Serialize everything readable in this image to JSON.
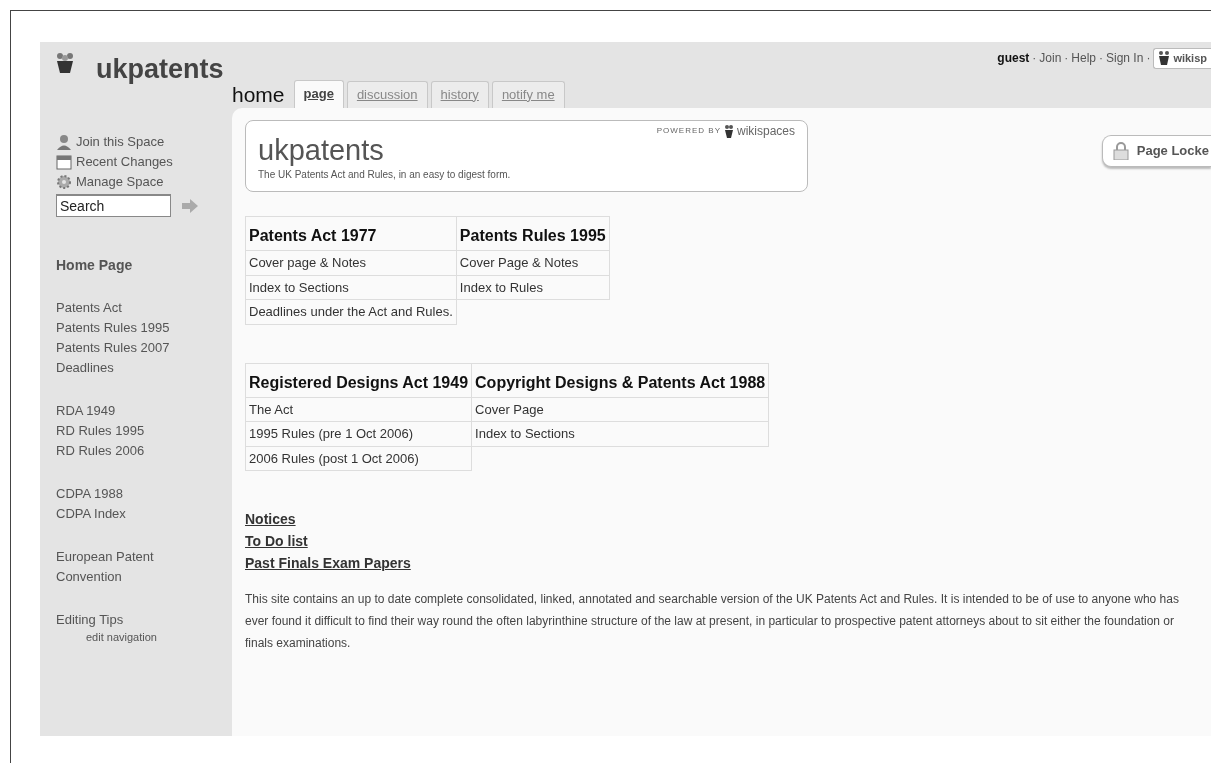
{
  "site": {
    "name": "ukpatents"
  },
  "user_bar": {
    "user": "guest",
    "links": [
      "Join",
      "Help",
      "Sign In"
    ],
    "separator": "·",
    "brand": "wikisp"
  },
  "page_name": "home",
  "tabs": [
    {
      "label": "page",
      "selected": true
    },
    {
      "label": "discussion",
      "selected": false
    },
    {
      "label": "history",
      "selected": false
    },
    {
      "label": "notify me",
      "selected": false
    }
  ],
  "sidebar": {
    "actions": [
      {
        "label": "Join this Space"
      },
      {
        "label": "Recent Changes"
      },
      {
        "label": "Manage Space"
      }
    ],
    "search": {
      "value": "Search"
    },
    "nav_groups": [
      {
        "items": [
          {
            "label": "Home Page",
            "bold": true
          }
        ]
      },
      {
        "items": [
          {
            "label": "Patents Act",
            "bold": false
          },
          {
            "label": "Patents Rules 1995",
            "bold": false
          },
          {
            "label": "Patents Rules 2007",
            "bold": false
          },
          {
            "label": "Deadlines",
            "bold": false
          }
        ]
      },
      {
        "items": [
          {
            "label": "RDA 1949",
            "bold": false
          },
          {
            "label": "RD Rules 1995",
            "bold": false
          },
          {
            "label": "RD Rules 2006",
            "bold": false
          }
        ]
      },
      {
        "items": [
          {
            "label": "CDPA 1988",
            "bold": false
          },
          {
            "label": "CDPA Index",
            "bold": false
          }
        ]
      },
      {
        "items": [
          {
            "label": "European Patent Convention",
            "bold": false
          }
        ]
      },
      {
        "items": [
          {
            "label": "Editing Tips",
            "bold": false
          }
        ]
      }
    ],
    "edit_link": "edit navigation"
  },
  "header_box": {
    "title": "ukpatents",
    "tagline": "The UK Patents Act and Rules, in an easy to digest form.",
    "powered_by": "POWERED BY",
    "brand": "wikispaces"
  },
  "lock_button": {
    "label": "Page Locke"
  },
  "tables": [
    {
      "columns": [
        {
          "heading": "Patents Act 1977",
          "rows": [
            {
              "link": "Cover page & Notes"
            },
            {
              "link": "Index to Sections"
            },
            {
              "link": "Deadlines",
              "text": "under the Act and Rules."
            }
          ]
        },
        {
          "heading": "Patents Rules 1995",
          "rows": [
            {
              "link": "Cover Page & Notes"
            },
            {
              "link": "Index to Rules"
            }
          ]
        }
      ]
    },
    {
      "columns": [
        {
          "heading": "Registered Designs Act 1949",
          "rows": [
            {
              "link": "The Act"
            },
            {
              "link": "1995 Rules",
              "text": "(pre 1 Oct 2006)"
            },
            {
              "link": "2006 Rules",
              "text": "(post 1 Oct 2006)"
            }
          ]
        },
        {
          "heading": "Copyright Designs & Patents Act 1988",
          "rows": [
            {
              "link": "Cover Page"
            },
            {
              "link": "Index to Sections"
            }
          ]
        }
      ]
    }
  ],
  "bold_links": [
    "Notices",
    "To Do list",
    "Past Finals Exam Papers"
  ],
  "intro": "This site contains an up to date complete consolidated, linked, annotated and searchable version of the UK Patents Act and Rules. It is intended to be of use to anyone who has ever found it difficult to find their way round the often labyrinthine structure of the law at present, in particular to prospective patent attorneys about to sit either the foundation or finals examinations."
}
